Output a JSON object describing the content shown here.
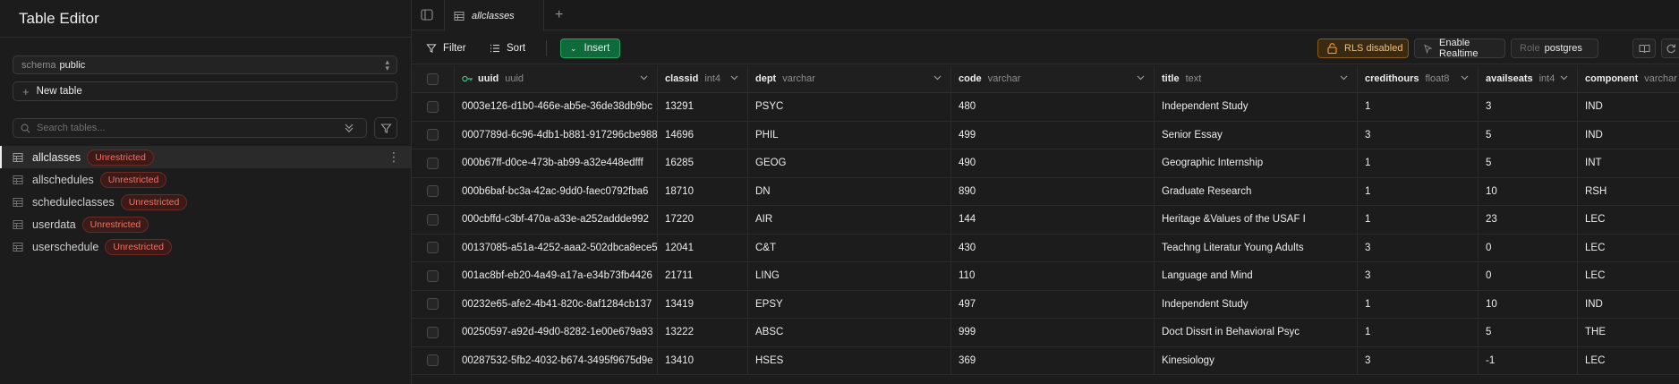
{
  "sidebar": {
    "title": "Table Editor",
    "schema_label": "schema",
    "schema_value": "public",
    "new_table_label": "New table",
    "search_placeholder": "Search tables...",
    "tables": [
      {
        "name": "allclasses",
        "badge": "Unrestricted",
        "active": true
      },
      {
        "name": "allschedules",
        "badge": "Unrestricted",
        "active": false
      },
      {
        "name": "scheduleclasses",
        "badge": "Unrestricted",
        "active": false
      },
      {
        "name": "userdata",
        "badge": "Unrestricted",
        "active": false
      },
      {
        "name": "userschedule",
        "badge": "Unrestricted",
        "active": false
      }
    ]
  },
  "tabs": [
    {
      "label": "allclasses"
    }
  ],
  "toolbar": {
    "filter_label": "Filter",
    "sort_label": "Sort",
    "insert_label": "Insert",
    "rls_label": "RLS disabled",
    "realtime_label": "Enable Realtime",
    "role_label": "Role",
    "role_value": "postgres"
  },
  "columns": [
    {
      "name": "uuid",
      "type": "uuid",
      "key": true
    },
    {
      "name": "classid",
      "type": "int4"
    },
    {
      "name": "dept",
      "type": "varchar"
    },
    {
      "name": "code",
      "type": "varchar"
    },
    {
      "name": "title",
      "type": "text"
    },
    {
      "name": "credithours",
      "type": "float8"
    },
    {
      "name": "availseats",
      "type": "int4"
    },
    {
      "name": "component",
      "type": "varchar"
    }
  ],
  "rows": [
    [
      "0003e126-d1b0-466e-ab5e-36de38db9bc",
      "13291",
      "PSYC",
      "480",
      "Independent Study",
      "1",
      "3",
      "IND"
    ],
    [
      "0007789d-6c96-4db1-b881-917296cbe988",
      "14696",
      "PHIL",
      "499",
      "Senior Essay",
      "3",
      "5",
      "IND"
    ],
    [
      "000b67ff-d0ce-473b-ab99-a32e448edfff",
      "16285",
      "GEOG",
      "490",
      "Geographic Internship",
      "1",
      "5",
      "INT"
    ],
    [
      "000b6baf-bc3a-42ac-9dd0-faec0792fba6",
      "18710",
      "DN",
      "890",
      "Graduate Research",
      "1",
      "10",
      "RSH"
    ],
    [
      "000cbffd-c3bf-470a-a33e-a252addde992",
      "17220",
      "AIR",
      "144",
      "Heritage &Values of the USAF I",
      "1",
      "23",
      "LEC"
    ],
    [
      "00137085-a51a-4252-aaa2-502dbca8ece5",
      "12041",
      "C&T",
      "430",
      "Teachng Literatur Young Adults",
      "3",
      "0",
      "LEC"
    ],
    [
      "001ac8bf-eb20-4a49-a17a-e34b73fb4426",
      "21711",
      "LING",
      "110",
      "Language and Mind",
      "3",
      "0",
      "LEC"
    ],
    [
      "00232e65-afe2-4b41-820c-8af1284cb137",
      "13419",
      "EPSY",
      "497",
      "Independent Study",
      "1",
      "10",
      "IND"
    ],
    [
      "00250597-a92d-49d0-8282-1e00e679a93",
      "13222",
      "ABSC",
      "999",
      "Doct Dissrt in Behavioral Psyc",
      "1",
      "5",
      "THE"
    ],
    [
      "00287532-5fb2-4032-b674-3495f9675d9e",
      "13410",
      "HSES",
      "369",
      "Kinesiology",
      "3",
      "-1",
      "LEC"
    ]
  ],
  "colors": {
    "accent_green": "#0f6a3c",
    "badge_red": "#f07366",
    "rls_amber": "#f2c07a"
  }
}
